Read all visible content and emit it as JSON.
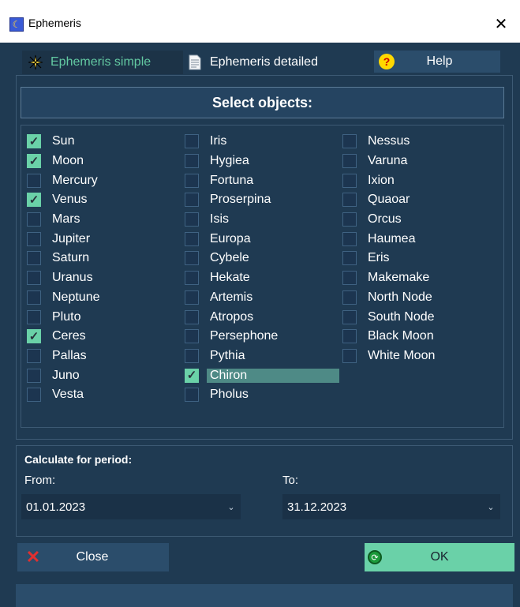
{
  "window": {
    "title": "Ephemeris",
    "close_glyph": "✕"
  },
  "tabs": [
    {
      "label": "Ephemeris simple",
      "icon": "sparkle-icon",
      "active": true
    },
    {
      "label": "Ephemeris detailed",
      "icon": "document-icon",
      "active": false
    }
  ],
  "help": {
    "label": "Help",
    "icon_glyph": "?"
  },
  "objects": {
    "header": "Select objects:",
    "columns": [
      [
        {
          "label": "Sun",
          "checked": true
        },
        {
          "label": "Moon",
          "checked": true
        },
        {
          "label": "Mercury",
          "checked": false
        },
        {
          "label": "Venus",
          "checked": true
        },
        {
          "label": "Mars",
          "checked": false
        },
        {
          "label": "Jupiter",
          "checked": false
        },
        {
          "label": "Saturn",
          "checked": false
        },
        {
          "label": "Uranus",
          "checked": false
        },
        {
          "label": "Neptune",
          "checked": false
        },
        {
          "label": "Pluto",
          "checked": false
        },
        {
          "label": "Ceres",
          "checked": true
        },
        {
          "label": "Pallas",
          "checked": false
        },
        {
          "label": "Juno",
          "checked": false
        },
        {
          "label": "Vesta",
          "checked": false
        }
      ],
      [
        {
          "label": "Iris",
          "checked": false
        },
        {
          "label": "Hygiea",
          "checked": false
        },
        {
          "label": "Fortuna",
          "checked": false
        },
        {
          "label": "Proserpina",
          "checked": false
        },
        {
          "label": "Isis",
          "checked": false
        },
        {
          "label": "Europa",
          "checked": false
        },
        {
          "label": "Cybele",
          "checked": false
        },
        {
          "label": "Hekate",
          "checked": false
        },
        {
          "label": "Artemis",
          "checked": false
        },
        {
          "label": "Atropos",
          "checked": false
        },
        {
          "label": "Persephone",
          "checked": false
        },
        {
          "label": "Pythia",
          "checked": false
        },
        {
          "label": "Chiron",
          "checked": true,
          "selected": true
        },
        {
          "label": "Pholus",
          "checked": false
        }
      ],
      [
        {
          "label": "Nessus",
          "checked": false
        },
        {
          "label": "Varuna",
          "checked": false
        },
        {
          "label": "Ixion",
          "checked": false
        },
        {
          "label": "Quaoar",
          "checked": false
        },
        {
          "label": "Orcus",
          "checked": false
        },
        {
          "label": "Haumea",
          "checked": false
        },
        {
          "label": "Eris",
          "checked": false
        },
        {
          "label": "Makemake",
          "checked": false
        },
        {
          "label": "North Node",
          "checked": false
        },
        {
          "label": "South Node",
          "checked": false
        },
        {
          "label": "Black Moon",
          "checked": false
        },
        {
          "label": "White Moon",
          "checked": false
        }
      ]
    ]
  },
  "period": {
    "title": "Calculate for period:",
    "from_label": "From:",
    "to_label": "To:",
    "from_value": "01.01.2023",
    "to_value": "31.12.2023"
  },
  "buttons": {
    "close_label": "Close",
    "ok_label": "OK"
  },
  "colors": {
    "accent": "#6ad1a8",
    "background": "#1f3a52",
    "selection": "#4e8a86"
  }
}
